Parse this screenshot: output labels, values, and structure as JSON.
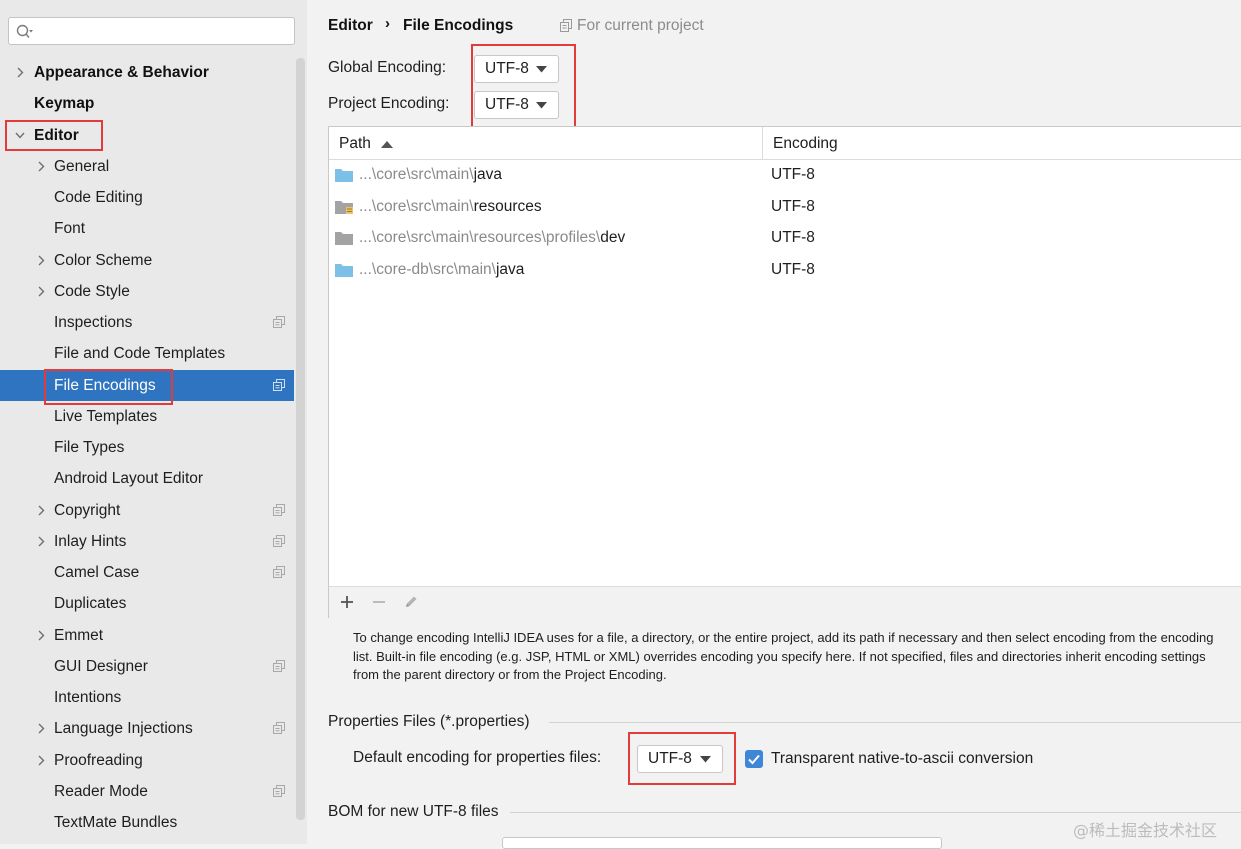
{
  "search": {
    "placeholder": "",
    "value": ""
  },
  "sidebar": {
    "items": [
      {
        "label": "Appearance & Behavior",
        "level": 0,
        "arrow": "right",
        "project": false
      },
      {
        "label": "Keymap",
        "level": 0,
        "arrow": "none",
        "project": false
      },
      {
        "label": "Editor",
        "level": 0,
        "arrow": "down",
        "project": false
      },
      {
        "label": "General",
        "level": 1,
        "arrow": "right",
        "project": false
      },
      {
        "label": "Code Editing",
        "level": 1,
        "arrow": "none",
        "project": false
      },
      {
        "label": "Font",
        "level": 1,
        "arrow": "none",
        "project": false
      },
      {
        "label": "Color Scheme",
        "level": 1,
        "arrow": "right",
        "project": false
      },
      {
        "label": "Code Style",
        "level": 1,
        "arrow": "right",
        "project": false
      },
      {
        "label": "Inspections",
        "level": 1,
        "arrow": "none",
        "project": true
      },
      {
        "label": "File and Code Templates",
        "level": 1,
        "arrow": "none",
        "project": false
      },
      {
        "label": "File Encodings",
        "level": 1,
        "arrow": "none",
        "project": true,
        "selected": true
      },
      {
        "label": "Live Templates",
        "level": 1,
        "arrow": "none",
        "project": false
      },
      {
        "label": "File Types",
        "level": 1,
        "arrow": "none",
        "project": false
      },
      {
        "label": "Android Layout Editor",
        "level": 1,
        "arrow": "none",
        "project": false
      },
      {
        "label": "Copyright",
        "level": 1,
        "arrow": "right",
        "project": true
      },
      {
        "label": "Inlay Hints",
        "level": 1,
        "arrow": "right",
        "project": true
      },
      {
        "label": "Camel Case",
        "level": 1,
        "arrow": "none",
        "project": true
      },
      {
        "label": "Duplicates",
        "level": 1,
        "arrow": "none",
        "project": false
      },
      {
        "label": "Emmet",
        "level": 1,
        "arrow": "right",
        "project": false
      },
      {
        "label": "GUI Designer",
        "level": 1,
        "arrow": "none",
        "project": true
      },
      {
        "label": "Intentions",
        "level": 1,
        "arrow": "none",
        "project": false
      },
      {
        "label": "Language Injections",
        "level": 1,
        "arrow": "right",
        "project": true
      },
      {
        "label": "Proofreading",
        "level": 1,
        "arrow": "right",
        "project": false
      },
      {
        "label": "Reader Mode",
        "level": 1,
        "arrow": "none",
        "project": true
      },
      {
        "label": "TextMate Bundles",
        "level": 1,
        "arrow": "none",
        "project": false
      }
    ]
  },
  "breadcrumb": {
    "parent": "Editor",
    "separator": "›",
    "current": "File Encodings",
    "scope": "For current project"
  },
  "global_encoding": {
    "label": "Global Encoding:",
    "value": "UTF-8"
  },
  "project_encoding": {
    "label": "Project Encoding:",
    "value": "UTF-8"
  },
  "table": {
    "col_path": "Path",
    "col_encoding": "Encoding",
    "rows": [
      {
        "icon": "source-folder-icon",
        "prefix": "...\\core\\src\\main\\",
        "name": "java",
        "encoding": "UTF-8"
      },
      {
        "icon": "resources-folder-icon",
        "prefix": "...\\core\\src\\main\\",
        "name": "resources",
        "encoding": "UTF-8"
      },
      {
        "icon": "folder-icon",
        "prefix": "...\\core\\src\\main\\resources\\profiles\\",
        "name": "dev",
        "encoding": "UTF-8"
      },
      {
        "icon": "source-folder-icon",
        "prefix": "...\\core-db\\src\\main\\",
        "name": "java",
        "encoding": "UTF-8"
      }
    ]
  },
  "help_text": "To change encoding IntelliJ IDEA uses for a file, a directory, or the entire project, add its path if necessary and then select encoding from the encoding list. Built-in file encoding (e.g. JSP, HTML or XML) overrides encoding you specify here. If not specified, files and directories inherit encoding settings from the parent directory or from the Project Encoding.",
  "properties": {
    "title": "Properties Files (*.properties)",
    "default_label": "Default encoding for properties files:",
    "default_value": "UTF-8",
    "transparent_label": "Transparent native-to-ascii conversion",
    "transparent_checked": true
  },
  "bom": {
    "title": "BOM for new UTF-8 files"
  },
  "watermark": "@稀土掘金技术社区",
  "colors": {
    "selection": "#2f74c0",
    "highlight": "#e23b3b",
    "checkbox": "#3e86d6",
    "folder_blue": "#7cc0e8",
    "folder_gray": "#a3a3a3"
  }
}
